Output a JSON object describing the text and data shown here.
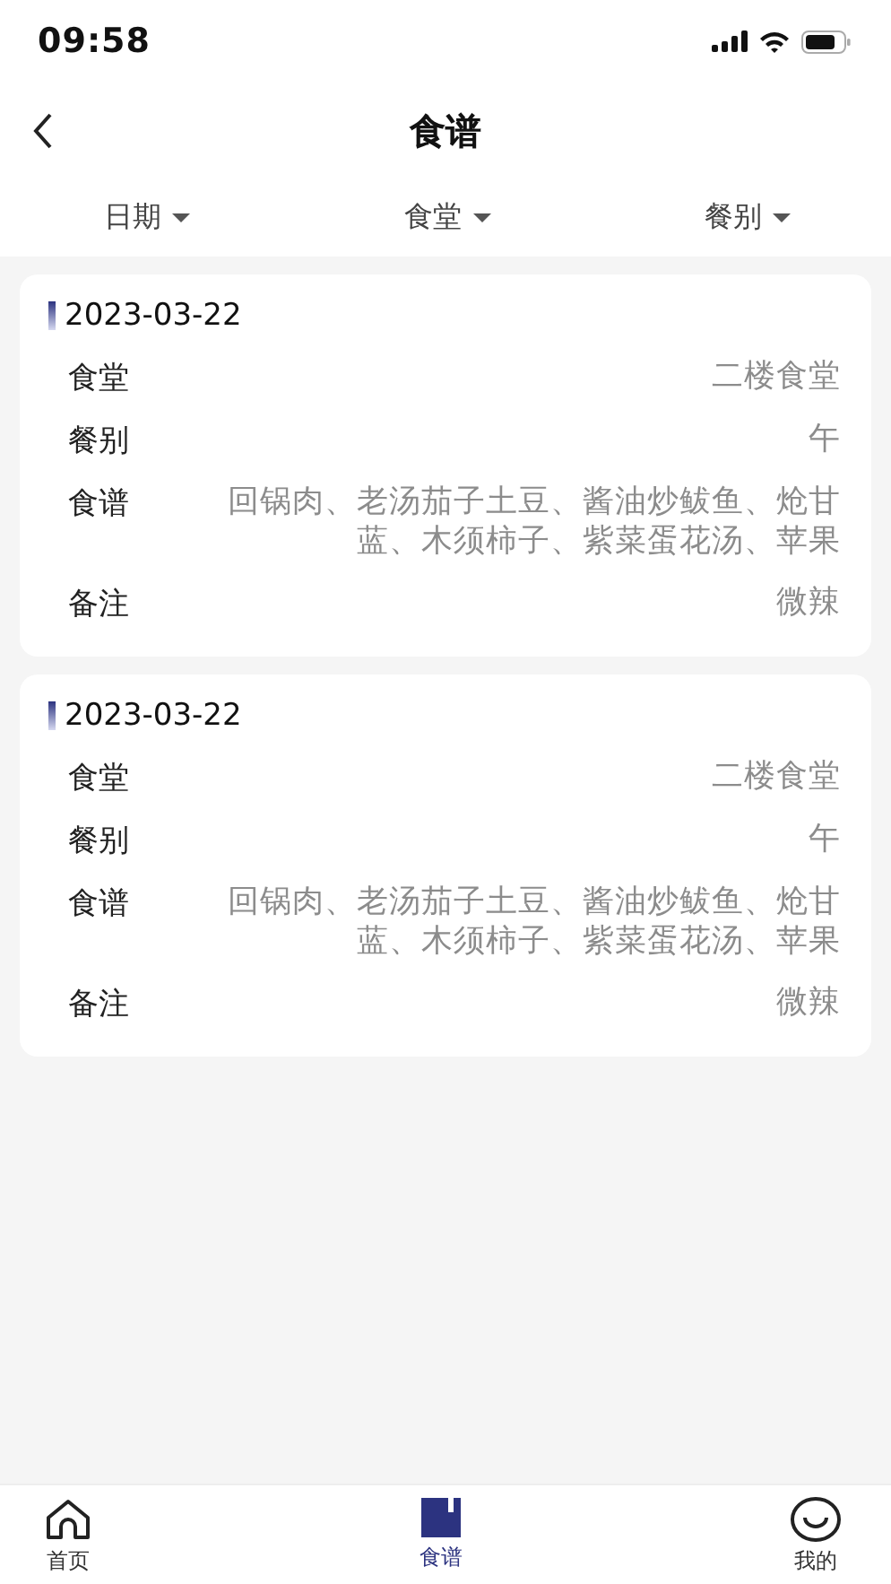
{
  "status_bar": {
    "time": "09:58"
  },
  "header": {
    "title": "食谱"
  },
  "filters": [
    {
      "label": "日期"
    },
    {
      "label": "食堂"
    },
    {
      "label": "餐别"
    }
  ],
  "records": [
    {
      "date": "2023-03-22",
      "fields": [
        {
          "label": "食堂",
          "value": "二楼食堂"
        },
        {
          "label": "餐别",
          "value": "午"
        },
        {
          "label": "食谱",
          "value": "回锅肉、老汤茄子土豆、酱油炒鲅鱼、炝甘蓝、木须柿子、紫菜蛋花汤、苹果"
        },
        {
          "label": "备注",
          "value": "微辣"
        }
      ]
    },
    {
      "date": "2023-03-22",
      "fields": [
        {
          "label": "食堂",
          "value": "二楼食堂"
        },
        {
          "label": "餐别",
          "value": "午"
        },
        {
          "label": "食谱",
          "value": "回锅肉、老汤茄子土豆、酱油炒鲅鱼、炝甘蓝、木须柿子、紫菜蛋花汤、苹果"
        },
        {
          "label": "备注",
          "value": "微辣"
        }
      ]
    }
  ],
  "tab_bar": [
    {
      "kind": "home",
      "label": "首页",
      "selected": false
    },
    {
      "kind": "book",
      "label": "食谱",
      "selected": true
    },
    {
      "kind": "smile",
      "label": "我的",
      "selected": false
    }
  ]
}
